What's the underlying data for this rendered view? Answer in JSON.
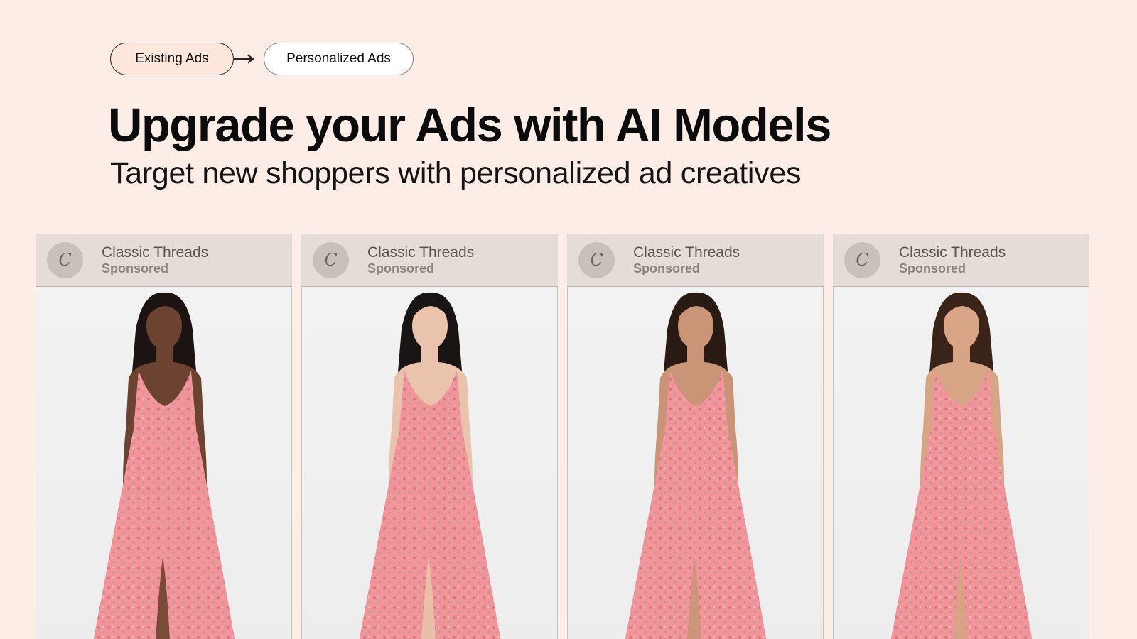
{
  "flow": {
    "existing_label": "Existing Ads",
    "personalized_label": "Personalized Ads"
  },
  "headline": "Upgrade your Ads with AI Models",
  "subheadline": "Target new shoppers with personalized ad creatives",
  "cards": [
    {
      "initial": "C",
      "brand": "Classic Threads",
      "sponsored": "Sponsored",
      "model": "model-1",
      "skin": "#6b4330",
      "hair": "#1b1412"
    },
    {
      "initial": "C",
      "brand": "Classic Threads",
      "sponsored": "Sponsored",
      "model": "model-2",
      "skin": "#e9c3ab",
      "hair": "#1a1515"
    },
    {
      "initial": "C",
      "brand": "Classic Threads",
      "sponsored": "Sponsored",
      "model": "model-3",
      "skin": "#c99576",
      "hair": "#2a1a14"
    },
    {
      "initial": "C",
      "brand": "Classic Threads",
      "sponsored": "Sponsored",
      "model": "model-4",
      "skin": "#d7a486",
      "hair": "#3a241a"
    }
  ],
  "colors": {
    "background": "#fcede6",
    "card_header": "#e6dcd7",
    "dress": "#f2959b",
    "dress_pattern": "#b9676f"
  }
}
